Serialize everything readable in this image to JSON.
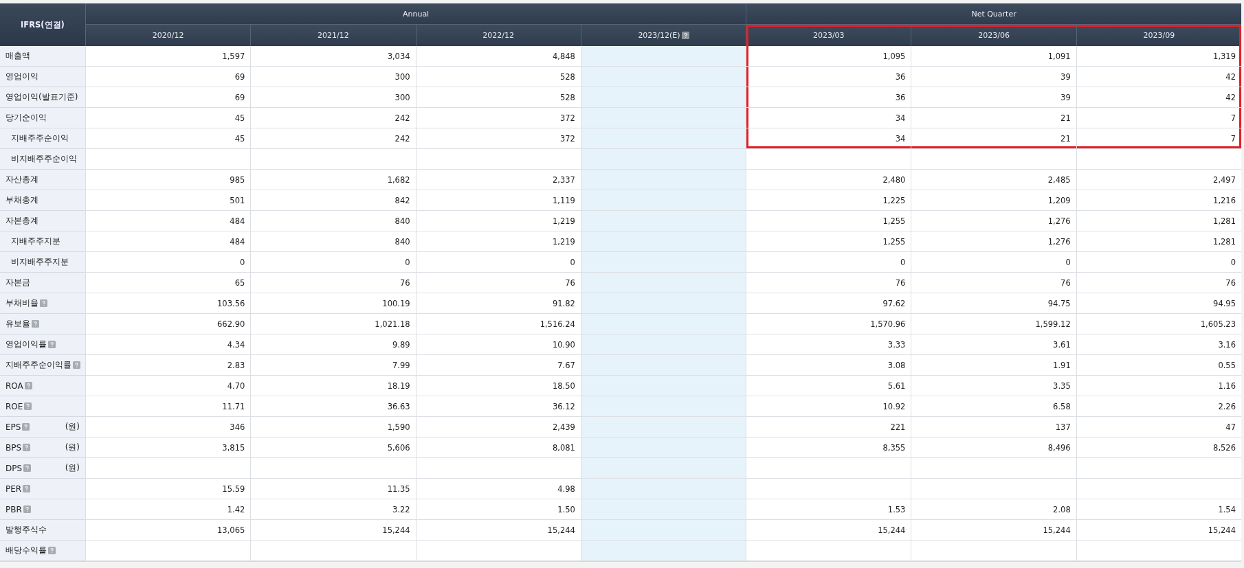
{
  "table": {
    "corner_label": "IFRS(연결)",
    "groups": [
      {
        "label": "Annual",
        "columns": [
          {
            "label": "2020/12",
            "estimate": false,
            "help": false,
            "highlighted": false
          },
          {
            "label": "2021/12",
            "estimate": false,
            "help": false,
            "highlighted": false
          },
          {
            "label": "2022/12",
            "estimate": false,
            "help": false,
            "highlighted": false
          },
          {
            "label": "2023/12(E)",
            "estimate": true,
            "help": true,
            "highlighted": false
          }
        ]
      },
      {
        "label": "Net Quarter",
        "columns": [
          {
            "label": "2023/03",
            "estimate": false,
            "help": false,
            "highlighted": true
          },
          {
            "label": "2023/06",
            "estimate": false,
            "help": false,
            "highlighted": true
          },
          {
            "label": "2023/09",
            "estimate": false,
            "help": false,
            "highlighted": true
          }
        ]
      }
    ],
    "rows": [
      {
        "label": "매출액",
        "help": false,
        "highlighted": true,
        "values": [
          "1,597",
          "3,034",
          "4,848",
          "1,095",
          "1,091",
          "1,319"
        ]
      },
      {
        "label": "영업이익",
        "help": false,
        "highlighted": true,
        "values": [
          "69",
          "300",
          "528",
          "36",
          "39",
          "42"
        ]
      },
      {
        "label": "영업이익(발표기준)",
        "help": false,
        "highlighted": true,
        "values": [
          "69",
          "300",
          "528",
          "36",
          "39",
          "42"
        ]
      },
      {
        "label": "당기순이익",
        "help": false,
        "highlighted": true,
        "values": [
          "45",
          "242",
          "372",
          "34",
          "21",
          "7"
        ],
        "children": [
          {
            "label": "지배주주순이익",
            "help": false,
            "highlighted": true,
            "values": [
              "45",
              "242",
              "372",
              "34",
              "21",
              "7"
            ]
          },
          {
            "label": "비지배주주순이익",
            "help": false,
            "highlighted": false
          }
        ]
      },
      {
        "label": "자산총계",
        "help": false,
        "highlighted": false,
        "values": [
          "985",
          "1,682",
          "2,337",
          "2,480",
          "2,485",
          "2,497"
        ]
      },
      {
        "label": "부채총계",
        "help": false,
        "highlighted": false,
        "values": [
          "501",
          "842",
          "1,119",
          "1,225",
          "1,209",
          "1,216"
        ]
      },
      {
        "label": "자본총계",
        "help": false,
        "highlighted": false,
        "values": [
          "484",
          "840",
          "1,219",
          "1,255",
          "1,276",
          "1,281"
        ],
        "children": [
          {
            "label": "지배주주지분",
            "help": false,
            "highlighted": false,
            "values": [
              "484",
              "840",
              "1,219",
              "1,255",
              "1,276",
              "1,281"
            ]
          },
          {
            "label": "비지배주주지분",
            "help": false,
            "highlighted": false,
            "values": [
              "0",
              "0",
              "0",
              "0",
              "0",
              "0"
            ]
          }
        ]
      },
      {
        "label": "자본금",
        "help": false,
        "highlighted": false,
        "values": [
          "65",
          "76",
          "76",
          "76",
          "76",
          "76"
        ]
      },
      {
        "label": "부채비율",
        "help": true,
        "highlighted": false,
        "values": [
          "103.56",
          "100.19",
          "91.82",
          "97.62",
          "94.75",
          "94.95"
        ]
      },
      {
        "label": "유보율",
        "help": true,
        "highlighted": false,
        "values": [
          "662.90",
          "1,021.18",
          "1,516.24",
          "1,570.96",
          "1,599.12",
          "1,605.23"
        ]
      },
      {
        "label": "영업이익률",
        "help": true,
        "highlighted": false,
        "values": [
          "4.34",
          "9.89",
          "10.90",
          "3.33",
          "3.61",
          "3.16"
        ]
      },
      {
        "label": "지배주주순이익률",
        "help": true,
        "highlighted": false,
        "values": [
          "2.83",
          "7.99",
          "7.67",
          "3.08",
          "1.91",
          "0.55"
        ]
      },
      {
        "label": "ROA",
        "help": true,
        "highlighted": false,
        "values": [
          "4.70",
          "18.19",
          "18.50",
          "5.61",
          "3.35",
          "1.16"
        ]
      },
      {
        "label": "ROE",
        "help": true,
        "highlighted": false,
        "values": [
          "11.71",
          "36.63",
          "36.12",
          "10.92",
          "6.58",
          "2.26"
        ]
      },
      {
        "label": "EPS",
        "help": true,
        "unit": "(원)",
        "highlighted": false,
        "values": [
          "346",
          "1,590",
          "2,439",
          "221",
          "137",
          "47"
        ]
      },
      {
        "label": "BPS",
        "help": true,
        "unit": "(원)",
        "highlighted": false,
        "values": [
          "3,815",
          "5,606",
          "8,081",
          "8,355",
          "8,496",
          "8,526"
        ]
      },
      {
        "label": "DPS",
        "help": true,
        "unit": "(원)",
        "highlighted": false
      },
      {
        "label": "PER",
        "help": true,
        "highlighted": false,
        "values": [
          "15.59",
          "11.35",
          "4.98"
        ]
      },
      {
        "label": "PBR",
        "help": true,
        "highlighted": false,
        "values": [
          "1.42",
          "3.22",
          "1.50",
          "1.53",
          "2.08",
          "1.54"
        ]
      },
      {
        "label": "발행주식수",
        "help": false,
        "highlighted": false,
        "values": [
          "13,065",
          "15,244",
          "15,244",
          "15,244",
          "15,244",
          "15,244"
        ]
      },
      {
        "label": "배당수익률",
        "help": true,
        "highlighted": false
      }
    ]
  }
}
